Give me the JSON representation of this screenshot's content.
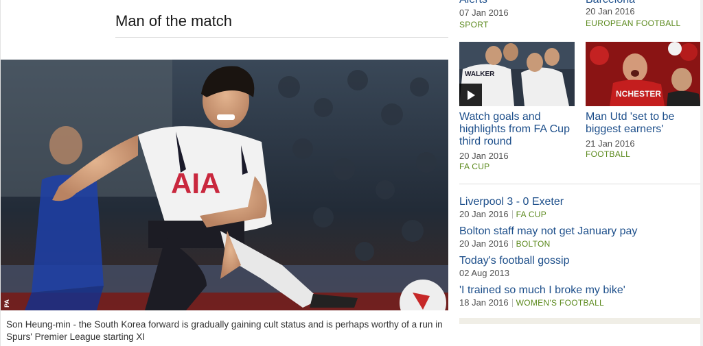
{
  "main": {
    "section_title": "Man of the match",
    "photo_credit": "PA",
    "photo_jersey_text": "AIA",
    "caption": "Son Heung-min - the South Korea forward is gradually gaining cult status and is perhaps worthy of a run in Spurs' Premier League starting XI"
  },
  "sidebar": {
    "top_items": [
      {
        "title_stub": "Alerts",
        "date": "07 Jan 2016",
        "tag": "SPORT"
      },
      {
        "title_stub": "Barcelona",
        "date": "20 Jan 2016",
        "tag": "EUROPEAN FOOTBALL"
      }
    ],
    "promos": [
      {
        "headline": "Watch goals and highlights from FA Cup third round",
        "date": "20 Jan 2016",
        "tag": "FA CUP",
        "has_video": true,
        "jersey_text": "WALKER",
        "icon": "play-icon"
      },
      {
        "headline": "Man Utd 'set to be biggest earners'",
        "date": "21 Jan 2016",
        "tag": "FOOTBALL",
        "has_video": false,
        "jersey_text": "NCHESTER"
      }
    ],
    "list": [
      {
        "headline": "Liverpool 3 - 0 Exeter",
        "date": "20 Jan 2016",
        "tag": "FA CUP"
      },
      {
        "headline": "Bolton staff may not get January pay",
        "date": "20 Jan 2016",
        "tag": "BOLTON"
      },
      {
        "headline": "Today's football gossip",
        "date": "02 Aug 2013",
        "tag": ""
      },
      {
        "headline": "'I trained so much I broke my bike'",
        "date": "18 Jan 2016",
        "tag": "WOMEN'S FOOTBALL"
      }
    ]
  },
  "colors": {
    "link": "#1c4e8a",
    "tag": "#5c8a1e",
    "meta": "#505050"
  }
}
